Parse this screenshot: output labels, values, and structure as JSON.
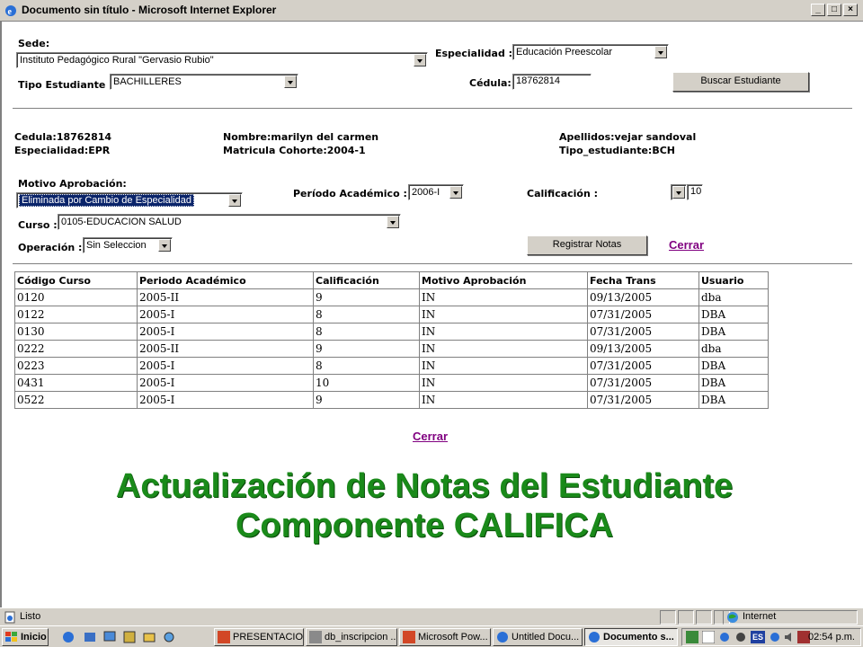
{
  "window": {
    "title": "Documento sin título - Microsoft Internet Explorer",
    "buttons": [
      "_",
      "□",
      "×"
    ]
  },
  "form": {
    "sede_label": "Sede:",
    "sede_value": "Instituto Pedagógico Rural \"Gervasio Rubio\"",
    "especialidad_label": "Especialidad :",
    "especialidad_value": "Educación Preescolar",
    "tipo_label": "Tipo Estudiante :",
    "tipo_value": "BACHILLERES",
    "cedula_label": "Cédula:",
    "cedula_value": "18762814",
    "buscar_button": "Buscar Estudiante"
  },
  "student": {
    "cedula": "Cedula:18762814",
    "especialidad": "Especialidad:EPR",
    "nombre": "Nombre:marilyn del carmen",
    "matricula": "Matricula Cohorte:2004-1",
    "apellidos": "Apellidos:vejar sandoval",
    "tipo": "Tipo_estudiante:BCH"
  },
  "grades_form": {
    "motivo_label": "Motivo Aprobación:",
    "motivo_value": "Eliminada por Cambio de Especialidad",
    "periodo_label": "Período Académico :",
    "periodo_value": "2006-I",
    "calificacion_label": "Calificación :",
    "calificacion_value": "10",
    "curso_label": "Curso :",
    "curso_value": "0105-EDUCACION SALUD",
    "operacion_label": "Operación :",
    "operacion_value": "Sin Seleccion",
    "registrar_button": "Registrar Notas",
    "cerrar_link": "Cerrar"
  },
  "table": {
    "headers": [
      "Código Curso",
      "Periodo Académico",
      "Calificación",
      "Motivo Aprobación",
      "Fecha Trans",
      "Usuario"
    ],
    "rows": [
      [
        "0120",
        "2005-II",
        "9",
        "IN",
        "09/13/2005",
        "dba"
      ],
      [
        "0122",
        "2005-I",
        "8",
        "IN",
        "07/31/2005",
        "DBA"
      ],
      [
        "0130",
        "2005-I",
        "8",
        "IN",
        "07/31/2005",
        "DBA"
      ],
      [
        "0222",
        "2005-II",
        "9",
        "IN",
        "09/13/2005",
        "dba"
      ],
      [
        "0223",
        "2005-I",
        "8",
        "IN",
        "07/31/2005",
        "DBA"
      ],
      [
        "0431",
        "2005-I",
        "10",
        "IN",
        "07/31/2005",
        "DBA"
      ],
      [
        "0522",
        "2005-I",
        "9",
        "IN",
        "07/31/2005",
        "DBA"
      ]
    ]
  },
  "bottom_link": "Cerrar",
  "slide_title": {
    "line1": "Actualización de Notas del Estudiante",
    "line2": "Componente CALIFICA"
  },
  "statusbar": {
    "text": "Listo",
    "zone": "Internet"
  },
  "taskbar": {
    "start": "Inicio",
    "tasks": [
      "PRESENTACIO...",
      "db_inscripcion ...",
      "Microsoft Pow...",
      "Untitled Docu...",
      "Documento s..."
    ],
    "clock": "02:54 p.m.",
    "lang": "ES"
  },
  "colors": {
    "title_green": "#1a8a1a",
    "link_visited": "#800080",
    "selection_blue": "#0a246a"
  }
}
